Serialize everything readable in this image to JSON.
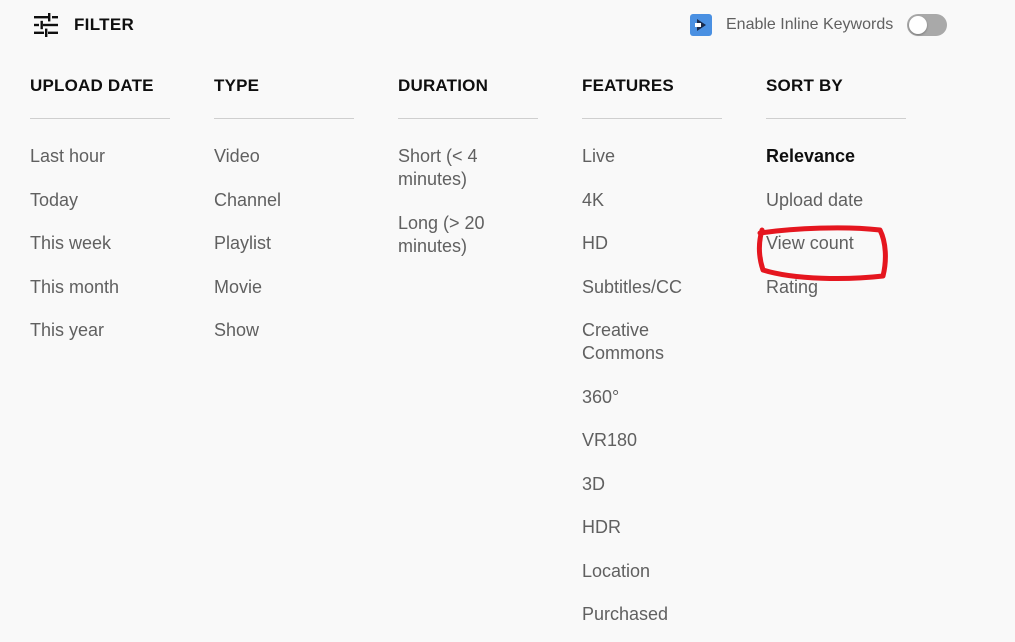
{
  "header": {
    "filter_label": "FILTER",
    "filter_icon": "tune-sliders-icon",
    "extension_icon": "inline-keywords-extension-icon",
    "inline_keywords_label": "Enable Inline Keywords",
    "inline_keywords_enabled": false
  },
  "columns": [
    {
      "title": "UPLOAD DATE",
      "options": [
        {
          "label": "Last hour"
        },
        {
          "label": "Today"
        },
        {
          "label": "This week"
        },
        {
          "label": "This month"
        },
        {
          "label": "This year"
        }
      ]
    },
    {
      "title": "TYPE",
      "options": [
        {
          "label": "Video"
        },
        {
          "label": "Channel"
        },
        {
          "label": "Playlist"
        },
        {
          "label": "Movie"
        },
        {
          "label": "Show"
        }
      ]
    },
    {
      "title": "DURATION",
      "options": [
        {
          "label": "Short (< 4 minutes)"
        },
        {
          "label": "Long (> 20 minutes)"
        }
      ]
    },
    {
      "title": "FEATURES",
      "options": [
        {
          "label": "Live"
        },
        {
          "label": "4K"
        },
        {
          "label": "HD"
        },
        {
          "label": "Subtitles/CC"
        },
        {
          "label": "Creative Commons"
        },
        {
          "label": "360°"
        },
        {
          "label": "VR180"
        },
        {
          "label": "3D"
        },
        {
          "label": "HDR"
        },
        {
          "label": "Location"
        },
        {
          "label": "Purchased"
        }
      ]
    },
    {
      "title": "SORT BY",
      "options": [
        {
          "label": "Relevance",
          "selected": true
        },
        {
          "label": "Upload date"
        },
        {
          "label": "View count",
          "annotated": true
        },
        {
          "label": "Rating"
        }
      ]
    }
  ],
  "annotation": {
    "color": "#e5161f",
    "target": "View count"
  },
  "colors": {
    "background": "#f9f9f9",
    "text_primary": "#0f0f0f",
    "text_secondary": "#606060",
    "extension_blue": "#4a90e2",
    "toggle_off": "#a9a9a9"
  }
}
